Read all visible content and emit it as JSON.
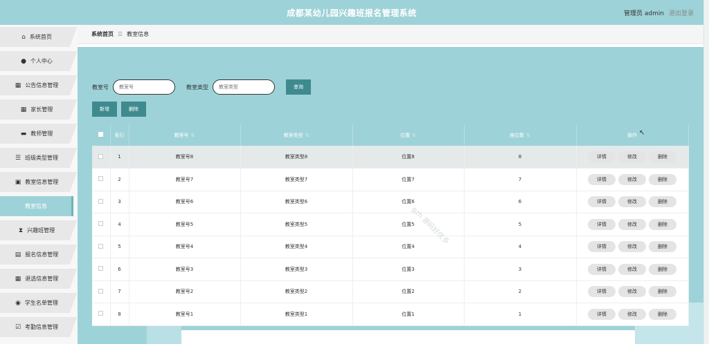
{
  "header": {
    "title": "成都某幼儿园兴趣班报名管理系统",
    "user": "管理员 admin",
    "logout": "退出登录"
  },
  "sidebar": {
    "items": [
      {
        "label": "系统首页",
        "icon": "home-icon"
      },
      {
        "label": "个人中心",
        "icon": "user-icon"
      },
      {
        "label": "公告信息管理",
        "icon": "grid-icon"
      },
      {
        "label": "家长管理",
        "icon": "grid-icon"
      },
      {
        "label": "教师管理",
        "icon": "briefcase-icon"
      },
      {
        "label": "班级类型管理",
        "icon": "sliders-icon"
      },
      {
        "label": "教室信息管理",
        "icon": "checklist-icon"
      },
      {
        "label": "教室信息",
        "icon": ""
      },
      {
        "label": "兴趣班管理",
        "icon": "hourglass-icon"
      },
      {
        "label": "报名信息管理",
        "icon": "clipboard-icon"
      },
      {
        "label": "退选信息管理",
        "icon": "grid-icon"
      },
      {
        "label": "学生名单管理",
        "icon": "pin-icon"
      },
      {
        "label": "考勤信息管理",
        "icon": "checkbox-icon"
      }
    ]
  },
  "breadcrumb": {
    "home": "系统首页",
    "current": "教室信息"
  },
  "search": {
    "label1": "教室号",
    "placeholder1": "教室号",
    "label2": "教室类型",
    "placeholder2": "教室类型",
    "button": "查询"
  },
  "actions": {
    "add": "新增",
    "delete": "删除"
  },
  "table": {
    "headers": [
      "索引",
      "教室号",
      "教室类型",
      "位置",
      "座位数",
      "操作"
    ],
    "rows": [
      {
        "index": "1",
        "room": "教室号8",
        "type": "教室类型8",
        "loc": "位置8",
        "seats": "8"
      },
      {
        "index": "2",
        "room": "教室号7",
        "type": "教室类型7",
        "loc": "位置7",
        "seats": "7"
      },
      {
        "index": "3",
        "room": "教室号6",
        "type": "教室类型6",
        "loc": "位置6",
        "seats": "6"
      },
      {
        "index": "4",
        "room": "教室号5",
        "type": "教室类型5",
        "loc": "位置5",
        "seats": "5"
      },
      {
        "index": "5",
        "room": "教室号4",
        "type": "教室类型4",
        "loc": "位置4",
        "seats": "4"
      },
      {
        "index": "6",
        "room": "教室号3",
        "type": "教室类型3",
        "loc": "位置3",
        "seats": "3"
      },
      {
        "index": "7",
        "room": "教室号2",
        "type": "教室类型2",
        "loc": "位置2",
        "seats": "2"
      },
      {
        "index": "8",
        "room": "教室号1",
        "type": "教室类型1",
        "loc": "位置1",
        "seats": "1"
      }
    ],
    "ops": {
      "detail": "详情",
      "edit": "修改",
      "delete": "删除"
    }
  },
  "watermark": "gzh 源码好优多"
}
